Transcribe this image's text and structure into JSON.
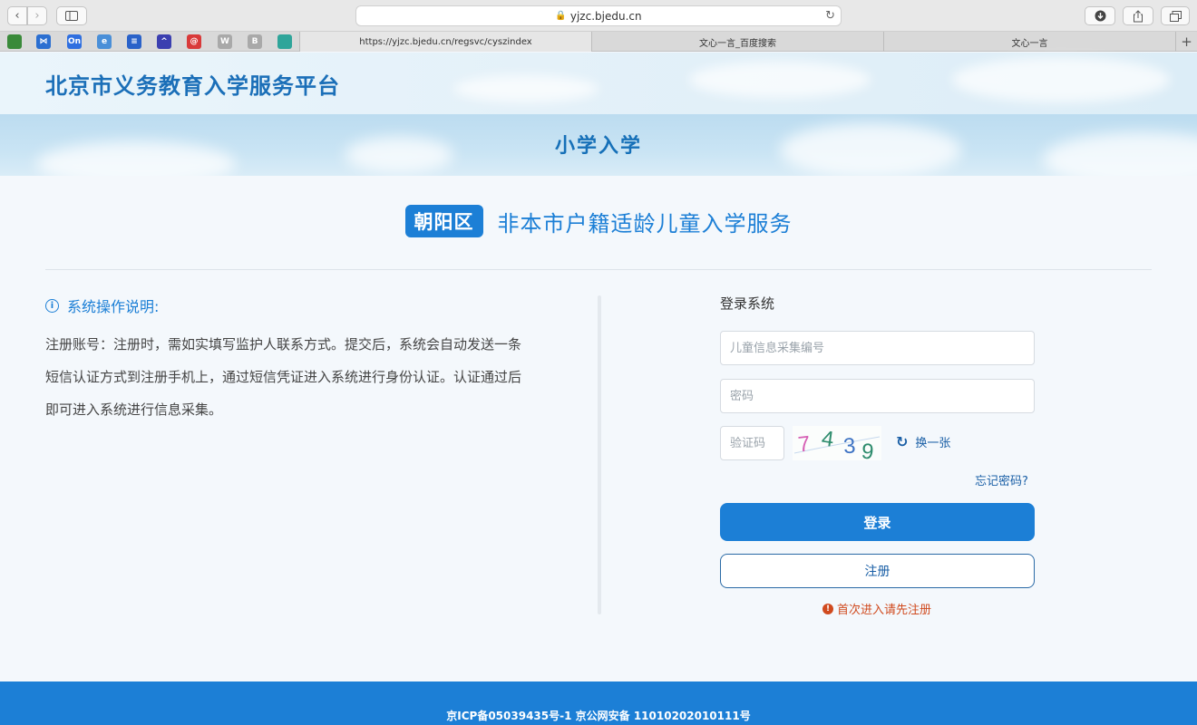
{
  "browser": {
    "address": "yjzc.bjedu.cn",
    "tabs": [
      {
        "label": "https://yjzc.bjedu.cn/regsvc/cyszindex",
        "active": true
      },
      {
        "label": "文心一言_百度搜索",
        "active": false
      },
      {
        "label": "文心一言",
        "active": false
      }
    ],
    "favorites": [
      {
        "icon": "leaf-icon",
        "glyph": "",
        "color": "#3a8a3a"
      },
      {
        "icon": "bowtie-icon",
        "glyph": "⋈",
        "color": "#2b6fd1"
      },
      {
        "icon": "on-icon",
        "glyph": "On",
        "color": "#2f6fe0"
      },
      {
        "icon": "browser-e-icon",
        "glyph": "e",
        "color": "#4a8fd8"
      },
      {
        "icon": "doc-icon",
        "glyph": "≡",
        "color": "#2a62c9"
      },
      {
        "icon": "mountain-icon",
        "glyph": "^",
        "color": "#3b3fb0"
      },
      {
        "icon": "at-icon",
        "glyph": "@",
        "color": "#d93a3a"
      },
      {
        "icon": "w-icon",
        "glyph": "W",
        "color": "#a9a9a9"
      },
      {
        "icon": "b-icon",
        "glyph": "B",
        "color": "#a9a9a9"
      },
      {
        "icon": "globe-icon",
        "glyph": "",
        "color": "#2fa59a"
      }
    ]
  },
  "header": {
    "site_title": "北京市义务教育入学服务平台",
    "banner_title": "小学入学"
  },
  "service": {
    "district": "朝阳区",
    "title": "非本市户籍适龄儿童入学服务"
  },
  "info": {
    "title": "系统操作说明:",
    "text": "注册账号：注册时，需如实填写监护人联系方式。提交后，系统会自动发送一条短信认证方式到注册手机上，通过短信凭证进入系统进行身份认证。认证通过后即可进入系统进行信息采集。"
  },
  "login": {
    "title": "登录系统",
    "id_placeholder": "儿童信息采集编号",
    "password_placeholder": "密码",
    "captcha_placeholder": "验证码",
    "captcha_code": "7439",
    "refresh_label": "换一张",
    "forgot_label": "忘记密码?",
    "login_label": "登录",
    "register_label": "注册",
    "notice": "首次进入请先注册"
  },
  "footer": {
    "text": "京ICP备05039435号-1 京公网安备 11010202010111号"
  }
}
